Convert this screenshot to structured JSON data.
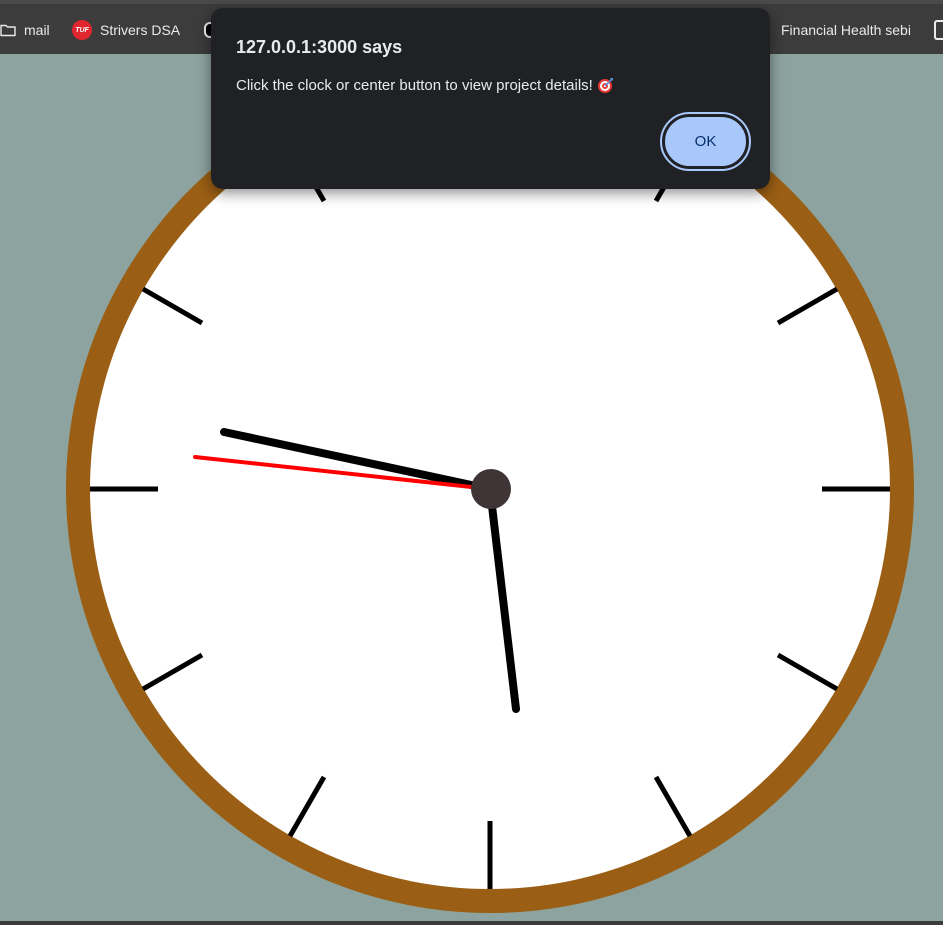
{
  "bookmarks": {
    "folder_label": "mail",
    "strivers_label": "Strivers DSA",
    "strivers_icon_text": "TUF",
    "financial_label": "Financial Health sebi"
  },
  "dialog": {
    "title": "127.0.0.1:3000 says",
    "message": "Click the clock or center button to view project details!",
    "ok_label": "OK"
  },
  "colors": {
    "background": "#8da39f",
    "clock_rim": "#9a5f14",
    "clock_face": "#ffffff",
    "second_hand": "#ff0000",
    "center_button": "#3f3536"
  },
  "icons": {
    "folder": "folder-icon",
    "strivers": "tuf-logo-icon",
    "message_emoji": "direct-hit-target-icon"
  }
}
